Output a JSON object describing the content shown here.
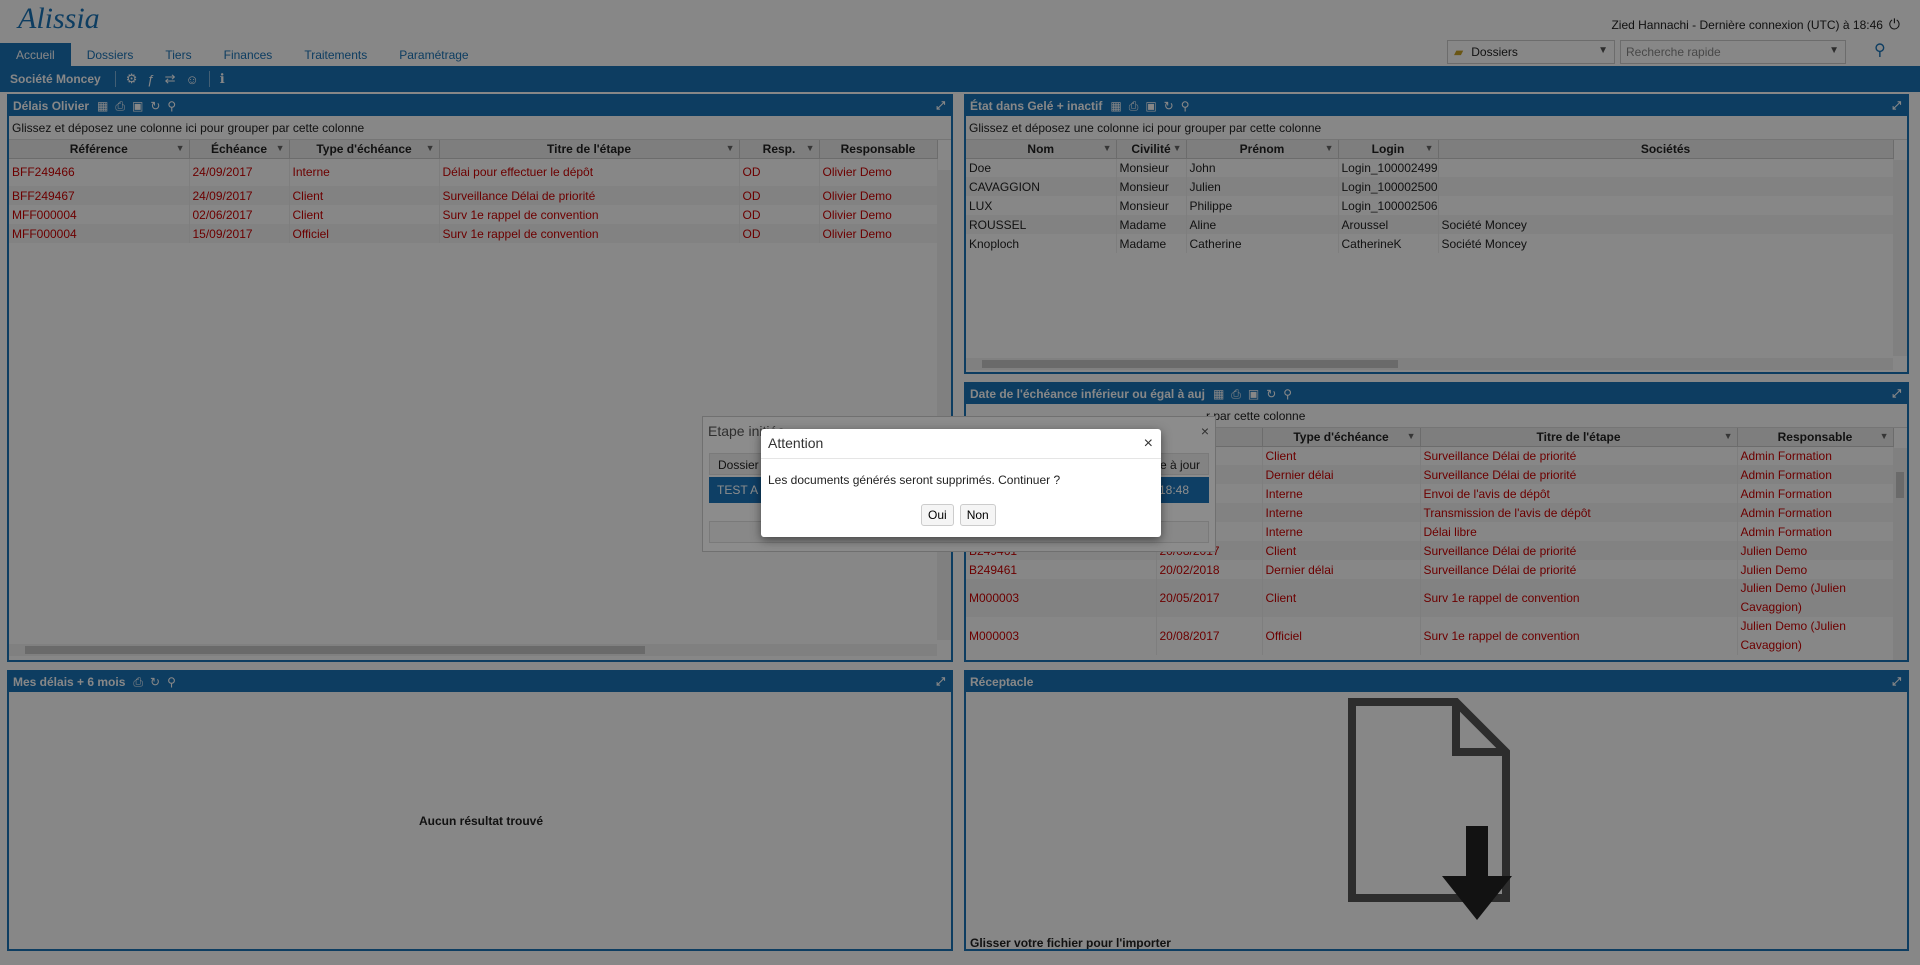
{
  "header": {
    "logo": "Alissia",
    "user_info": "Zied Hannachi - Dernière connexion (UTC) à 18:46",
    "tabs": [
      "Accueil",
      "Dossiers",
      "Tiers",
      "Finances",
      "Traitements",
      "Paramétrage"
    ],
    "dossier_select": "Dossiers",
    "quick_search_placeholder": "Recherche rapide"
  },
  "subbar": {
    "company": "Société Moncey"
  },
  "group_zone_text": "Glissez et déposez une colonne ici pour grouper par cette colonne",
  "panel_delais": {
    "title": "Délais Olivier",
    "columns": [
      "Référence",
      "Échéance",
      "Type d'échéance",
      "Titre de l'étape",
      "Resp.",
      "Responsable"
    ],
    "rows": [
      [
        "BFF249466",
        "24/09/2017",
        "Interne",
        "Délai pour effectuer le dépôt",
        "OD",
        "Olivier Demo"
      ],
      [
        "BFF249467",
        "24/09/2017",
        "Client",
        "Surveillance Délai de priorité",
        "OD",
        "Olivier Demo"
      ],
      [
        "MFF000004",
        "02/06/2017",
        "Client",
        "Surv 1e rappel de convention",
        "OD",
        "Olivier Demo"
      ],
      [
        "MFF000004",
        "15/09/2017",
        "Officiel",
        "Surv 1e rappel de convention",
        "OD",
        "Olivier Demo"
      ]
    ]
  },
  "panel_etat": {
    "title": "État dans Gelé + inactif",
    "columns": [
      "Nom",
      "Civilité",
      "Prénom",
      "Login",
      "Sociétés"
    ],
    "rows": [
      [
        "Doe",
        "Monsieur",
        "John",
        "Login_100002499",
        ""
      ],
      [
        "CAVAGGION",
        "Monsieur",
        "Julien",
        "Login_100002500",
        ""
      ],
      [
        "LUX",
        "Monsieur",
        "Philippe",
        "Login_100002506",
        ""
      ],
      [
        "ROUSSEL",
        "Madame",
        "Aline",
        "Aroussel",
        "Société Moncey"
      ],
      [
        "Knoploch",
        "Madame",
        "Catherine",
        "CatherineK",
        "Société Moncey"
      ]
    ]
  },
  "panel_date": {
    "title": "Date de l'échéance inférieur ou égal à auj",
    "group_zone_visible": "r par cette colonne",
    "columns": [
      "e",
      "Type d'échéance",
      "Titre de l'étape",
      "Responsable"
    ],
    "rows": [
      [
        "",
        "",
        "Client",
        "Surveillance Délai de priorité",
        "Admin Formation"
      ],
      [
        "",
        "",
        "Dernier délai",
        "Surveillance Délai de priorité",
        "Admin Formation"
      ],
      [
        "",
        "",
        "Interne",
        "Envoi de l'avis de dépôt",
        "Admin Formation"
      ],
      [
        "",
        "",
        "Interne",
        "Transmission de l'avis de dépôt",
        "Admin Formation"
      ],
      [
        "",
        "",
        "Interne",
        "Délai libre",
        "Admin Formation"
      ],
      [
        "B249461",
        "20/08/2017",
        "Client",
        "Surveillance Délai de priorité",
        "Julien Demo"
      ],
      [
        "B249461",
        "20/02/2018",
        "Dernier délai",
        "Surveillance Délai de priorité",
        "Julien Demo"
      ],
      [
        "M000003",
        "20/05/2017",
        "Client",
        "Surv 1e rappel de convention",
        "Julien Demo (Julien Cavaggion)"
      ],
      [
        "M000003",
        "20/08/2017",
        "Officiel",
        "Surv 1e rappel de convention",
        "Julien Demo (Julien Cavaggion)"
      ]
    ]
  },
  "panel_mes_delais": {
    "title": "Mes délais + 6 mois",
    "empty_text": "Aucun résultat trouvé"
  },
  "panel_receptacle": {
    "title": "Réceptacle",
    "drop_text": "Glisser votre fichier pour l'importer"
  },
  "behind_dialog": {
    "title": "Etape initiée",
    "col1": "Dossier",
    "col_last": "e à jour",
    "row_first": "TEST A",
    "row_last": "18:48"
  },
  "modal": {
    "title": "Attention",
    "message": "Les documents générés seront supprimés. Continuer ?",
    "yes_label": "Oui",
    "no_label": "Non"
  }
}
